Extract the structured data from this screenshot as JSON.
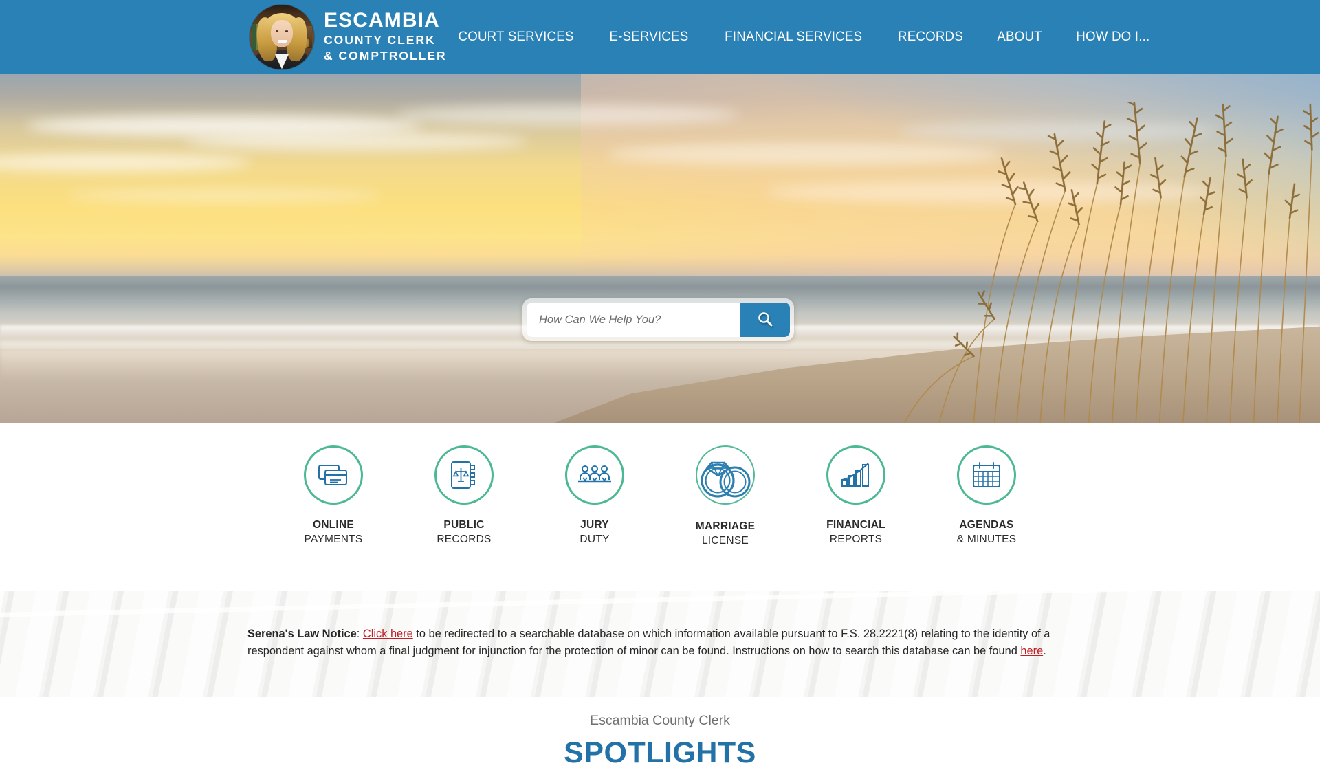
{
  "header": {
    "background_color": "#2981b5",
    "brand": {
      "photo_alt": "clerk-portrait",
      "line1": "ESCAMBIA",
      "line2": "COUNTY CLERK",
      "line3": "& COMPTROLLER"
    },
    "nav": [
      {
        "label": "COURT SERVICES"
      },
      {
        "label": "E-SERVICES"
      },
      {
        "label": "FINANCIAL SERVICES"
      },
      {
        "label": "RECORDS"
      },
      {
        "label": "ABOUT"
      },
      {
        "label": "HOW DO I..."
      }
    ]
  },
  "hero": {
    "image_alt": "beach-sunset-sea-oats",
    "search": {
      "placeholder": "How Can We Help You?",
      "value": "",
      "button_icon": "search-icon",
      "button_color": "#2981b5"
    }
  },
  "services": {
    "ring_color": "#4cb894",
    "icon_color": "#2272a8",
    "items": [
      {
        "icon": "credit-card-icon",
        "line1": "ONLINE",
        "line2": "PAYMENTS"
      },
      {
        "icon": "law-book-icon",
        "line1": "PUBLIC",
        "line2": "RECORDS"
      },
      {
        "icon": "jury-people-icon",
        "line1": "JURY",
        "line2": "DUTY"
      },
      {
        "icon": "wedding-rings-icon",
        "line1": "MARRIAGE",
        "line2": "LICENSE"
      },
      {
        "icon": "bar-chart-icon",
        "line1": "FINANCIAL",
        "line2": "REPORTS"
      },
      {
        "icon": "calendar-icon",
        "line1": "AGENDAS",
        "line2": "& MINUTES"
      }
    ]
  },
  "notice": {
    "label": "Serena's Law Notice",
    "after_label": ": ",
    "link1": "Click here",
    "body1": " to be redirected to a searchable database on which information available pursuant to F.S. 28.2221(8) relating to the identity of a respondent against whom a final judgment for injunction for the protection of minor can be found.   Instructions on how to search this database can be found ",
    "link2": "here",
    "body2": ".",
    "link_color": "#c02026"
  },
  "spotlights": {
    "subtitle": "Escambia County Clerk",
    "title": "SPOTLIGHTS",
    "title_color": "#2272a8"
  }
}
